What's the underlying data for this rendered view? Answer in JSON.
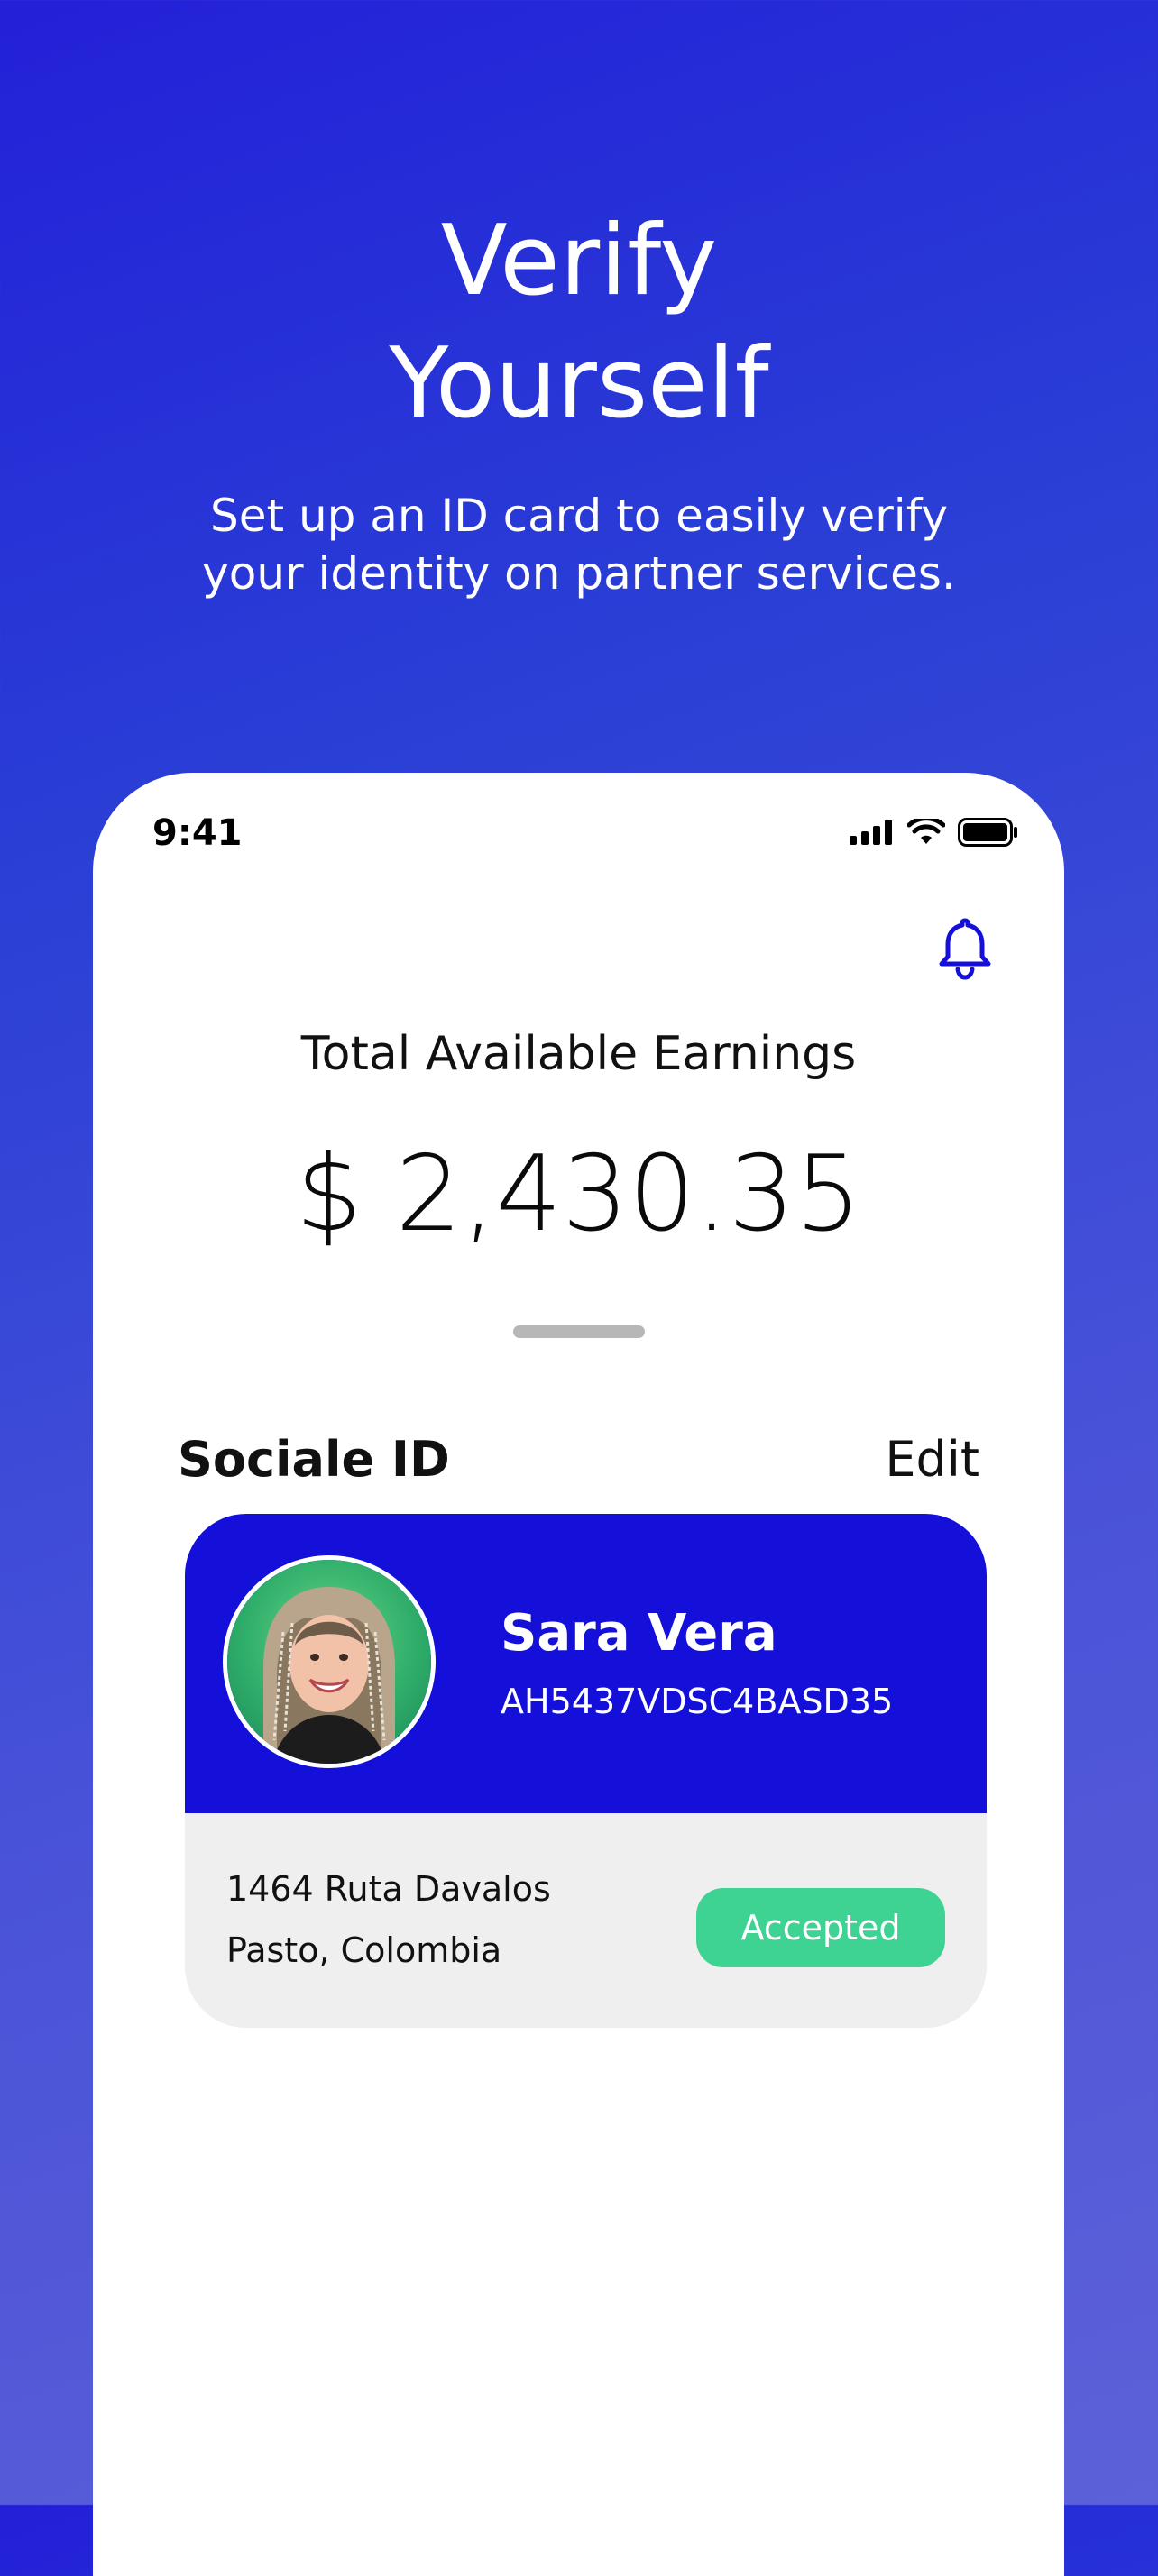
{
  "hero": {
    "title_line1": "Verify",
    "title_line2": "Yourself",
    "subtitle_line1": "Set up an ID card to easily verify",
    "subtitle_line2": "your identity on partner services."
  },
  "status_bar": {
    "time": "9:41",
    "icons": [
      "cellular-signal-icon",
      "wifi-icon",
      "battery-icon"
    ]
  },
  "header": {
    "icon": "bell-icon",
    "accent_color": "#1410d9"
  },
  "earnings": {
    "label": "Total Available Earnings",
    "amount": "$ 2,430.35"
  },
  "section": {
    "title": "Sociale ID",
    "edit_label": "Edit"
  },
  "id_card": {
    "name": "Sara Vera",
    "id_code": "AH5437VDSC4BASD35",
    "address_line1": "1464 Ruta Davalos",
    "address_line2": "Pasto, Colombia",
    "status": "Accepted",
    "status_color": "#3ed392",
    "card_color": "#1410d9"
  }
}
